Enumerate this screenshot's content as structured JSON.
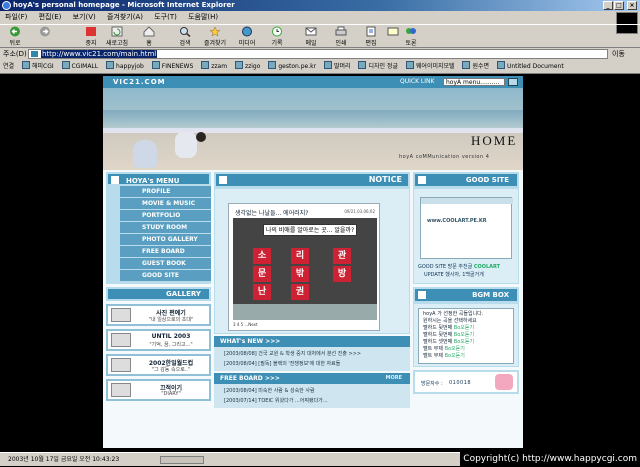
{
  "window": {
    "title": "hoyA's personal homepage - Microsoft Internet Explorer",
    "controls": [
      "_",
      "□",
      "×"
    ]
  },
  "menu": [
    "파일(F)",
    "편집(E)",
    "보기(V)",
    "즐겨찾기(A)",
    "도구(T)",
    "도움말(H)"
  ],
  "toolbar": [
    {
      "label": "뒤로",
      "icon": "back-arrow-icon"
    },
    {
      "label": "",
      "icon": "forward-arrow-icon"
    },
    {
      "label": "중지",
      "icon": "stop-icon"
    },
    {
      "label": "새로고침",
      "icon": "refresh-icon"
    },
    {
      "label": "홈",
      "icon": "home-icon"
    },
    {
      "label": "검색",
      "icon": "search-icon"
    },
    {
      "label": "즐겨찾기",
      "icon": "favorites-icon"
    },
    {
      "label": "미디어",
      "icon": "media-icon"
    },
    {
      "label": "기록",
      "icon": "history-icon"
    },
    {
      "label": "메일",
      "icon": "mail-icon"
    },
    {
      "label": "인쇄",
      "icon": "print-icon"
    },
    {
      "label": "편집",
      "icon": "edit-icon"
    },
    {
      "label": "",
      "icon": "discuss-icon"
    },
    {
      "label": "토론",
      "icon": "messenger-icon"
    }
  ],
  "address": {
    "label": "주소(D)",
    "url": "http://www.vic21.com/main.html",
    "go": "이동"
  },
  "links": {
    "label": "연결",
    "items": [
      "해피CGI",
      "CGIMALL",
      "happyjob",
      "FINENEWS",
      "zzam",
      "zzigo",
      "geston.pe.kr",
      "딸머리",
      "디자인 정글",
      "웨어이미지모텔",
      "원수면",
      "Untitled Document"
    ]
  },
  "site": {
    "logo": "VIC21.COM",
    "quick_link_label": "QUICK LINK",
    "quick_select": "hoyA menu..........",
    "hero_title": "HOME",
    "hero_subtitle": "hoyA coMMunication version 4",
    "menu_title": "HOYA's MENU",
    "menu_items": [
      "PROFILE",
      "MOVIE & MUSIC",
      "PORTFOLIO",
      "STUDY ROOM",
      "PHOTO GALLERY",
      "FREE BOARD",
      "GUEST BOOK",
      "GOOD SITE"
    ],
    "gallery_label": "GALLERY",
    "promos": [
      {
        "title": "사진 편예기",
        "sub": "\"내 일상으로의 초대\""
      },
      {
        "title": "UNTIL 2003",
        "sub": "\"기억, 꿈, 그리고...\""
      },
      {
        "title": "2002한일월드컵",
        "sub": "\"그 감동 속으로..\""
      },
      {
        "title": "끄적이기",
        "sub": "\"DIARY\""
      }
    ],
    "notice": {
      "title": "NOTICE",
      "post_title": "생각없는 나날들... 에어러지?",
      "post_date": "09/21.03.06:02",
      "photo_sign": "나의 비애를 알아로는 곳... 알을까?",
      "photo_chars": [
        "소",
        "리",
        "문",
        "밖",
        "난",
        "권",
        "관",
        "방"
      ],
      "footer": "3 4 5 ...Next"
    },
    "whats_new": {
      "title": "WHAT's NEW >>>",
      "items": [
        "[2003/08/08] 건국 교원 & 학생 중지 대처에서 분선 진출 >>>",
        "[2003/08/04] [필독] 블랙의 '전쟁정보'에 대한 자료들"
      ]
    },
    "free_board": {
      "title": "FREE BOARD >>>",
      "more": "MORE",
      "items": [
        "[2003/08/04] 미숙한 사람 & 성숙한 사람",
        "[2003/07/14] TOEIC 위왔다가 ...어찌됐다가..."
      ]
    },
    "good_site": {
      "title": "GOOD SITE",
      "shot_text": "www.COOLART.PE.KR",
      "cap1": "GOOD SITE 방문 추천글",
      "cap1_b": "COOLART",
      "cap2": "UPDATE 했사자, 1백골거게"
    },
    "bgm": {
      "title": "BGM BOX",
      "intro": [
        "hoyA 가 선정한 곡들입니다.",
        "원하시는 곡을 선택하세요"
      ],
      "tracks": [
        {
          "name": "멜하드 뒷번째",
          "tag": "Bo오듣기"
        },
        {
          "name": "멜하드 뒷번째",
          "tag": "Bo오듣기"
        },
        {
          "name": "멜하드 셋번째",
          "tag": "Bo오듣기"
        },
        {
          "name": "멜트 무제",
          "tag": "Bo오듣기"
        },
        {
          "name": "멜트 무제",
          "tag": "Bo오듣기"
        }
      ]
    },
    "counter": {
      "label": "방문자수 :",
      "value": "010018"
    }
  },
  "status": {
    "text": "2003년 10월 17일 금요일 오전 10:43:23"
  },
  "copyright": "Copyright(c) http://www.happycgi.com"
}
